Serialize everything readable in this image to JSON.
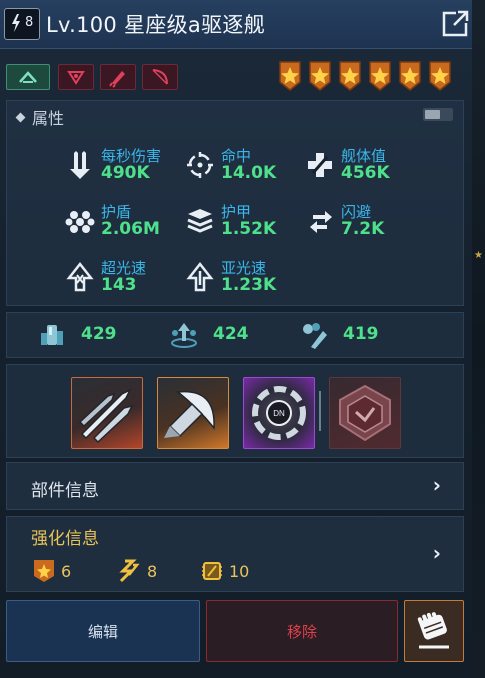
{
  "header": {
    "level_badge_num": "8",
    "title": "Lv.100 星座级a驱逐舰"
  },
  "stars_count": 6,
  "attributes": {
    "title": "属性",
    "stats": [
      {
        "label": "每秒伤害",
        "value": "490K",
        "icon": "dps-icon"
      },
      {
        "label": "命中",
        "value": "14.0K",
        "icon": "crosshair-icon"
      },
      {
        "label": "舰体值",
        "value": "456K",
        "icon": "hull-cross-icon"
      },
      {
        "label": "护盾",
        "value": "2.06M",
        "icon": "shield-hex-icon"
      },
      {
        "label": "护甲",
        "value": "1.52K",
        "icon": "armor-layers-icon"
      },
      {
        "label": "闪避",
        "value": "7.2K",
        "icon": "evasion-arrows-icon"
      },
      {
        "label": "超光速",
        "value": "143",
        "icon": "warp-speed-icon"
      },
      {
        "label": "亚光速",
        "value": "1.23K",
        "icon": "sublight-speed-icon"
      }
    ]
  },
  "resources": [
    {
      "value": "429",
      "icon": "ore-icon"
    },
    {
      "value": "424",
      "icon": "crystal-icon"
    },
    {
      "value": "419",
      "icon": "gas-icon"
    }
  ],
  "parts": {
    "label": "部件信息"
  },
  "enhance": {
    "label": "强化信息",
    "items": [
      {
        "value": "6",
        "icon": "star-badge-icon"
      },
      {
        "value": "8",
        "icon": "bolt-icon"
      },
      {
        "value": "10",
        "icon": "chip-icon"
      }
    ]
  },
  "buttons": {
    "edit": "编辑",
    "remove": "移除"
  },
  "colors": {
    "stat_label": "#3ab6e8",
    "stat_value": "#4ee08a",
    "enhance": "#e8c45a",
    "remove": "#e0404a"
  }
}
